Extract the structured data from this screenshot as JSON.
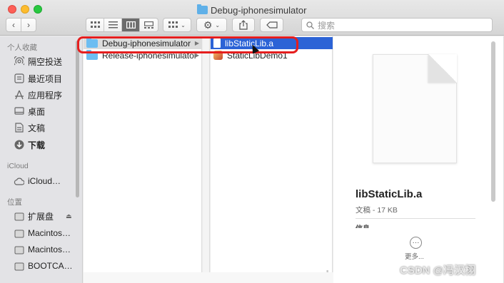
{
  "window": {
    "title": "Debug-iphonesimulator"
  },
  "toolbar": {
    "back": "‹",
    "forward": "›",
    "search_placeholder": "搜索"
  },
  "sidebar": {
    "favorites_header": "个人收藏",
    "favorites": [
      {
        "label": "隔空投送",
        "icon": "airdrop-icon"
      },
      {
        "label": "最近项目",
        "icon": "recents-icon"
      },
      {
        "label": "应用程序",
        "icon": "applications-icon"
      },
      {
        "label": "桌面",
        "icon": "desktop-icon"
      },
      {
        "label": "文稿",
        "icon": "documents-icon"
      },
      {
        "label": "下载",
        "icon": "downloads-icon"
      }
    ],
    "icloud_header": "iCloud",
    "icloud_items": [
      {
        "label": "iCloud…",
        "icon": "cloud-icon"
      }
    ],
    "locations_header": "位置",
    "locations": [
      {
        "label": "扩展盘",
        "icon": "drive-icon"
      },
      {
        "label": "Macintos…",
        "icon": "drive-icon"
      },
      {
        "label": "Macintos…",
        "icon": "drive-icon"
      },
      {
        "label": "BOOTCA…",
        "icon": "drive-icon"
      }
    ]
  },
  "columns": {
    "col1": [
      {
        "label": "Debug-iphonesimulator",
        "type": "folder"
      },
      {
        "label": "Release-iphonesimulator",
        "type": "folder"
      }
    ],
    "col3": [
      {
        "label": "libStaticLib.a",
        "type": "file"
      },
      {
        "label": "StaticLibDemo1",
        "type": "exec"
      }
    ]
  },
  "preview": {
    "name": "libStaticLib.a",
    "meta": "文稿 - 17 KB",
    "info_header": "信息",
    "more_label": "更多..."
  },
  "watermark": "CSDN @冯汉栩",
  "colors": {
    "selection_blue": "#2c63d6",
    "highlight_red": "#e51e1e",
    "folder_blue": "#6cbdf1"
  }
}
